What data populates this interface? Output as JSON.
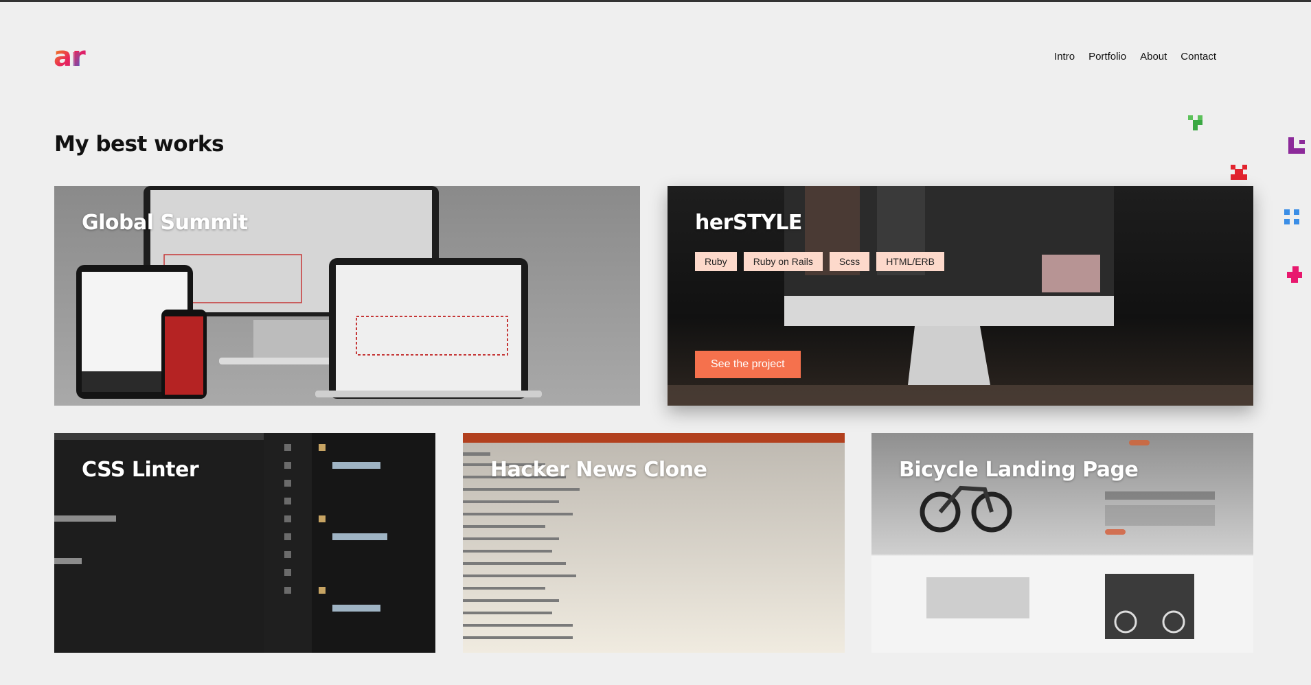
{
  "header": {
    "logo_text": "ar",
    "nav": [
      "Intro",
      "Portfolio",
      "About",
      "Contact"
    ]
  },
  "section": {
    "title": "My best works"
  },
  "projects": [
    {
      "title": "Global Summit"
    },
    {
      "title": "herSTYLE",
      "tags": [
        "Ruby",
        "Ruby on Rails",
        "Scss",
        "HTML/ERB"
      ],
      "cta": "See the project"
    },
    {
      "title": "CSS Linter"
    },
    {
      "title": "Hacker News Clone"
    },
    {
      "title": "Bicycle Landing Page"
    }
  ],
  "colors": {
    "accent": "#f5714d",
    "tag_bg": "#fdd9cb",
    "background": "#efefef"
  }
}
